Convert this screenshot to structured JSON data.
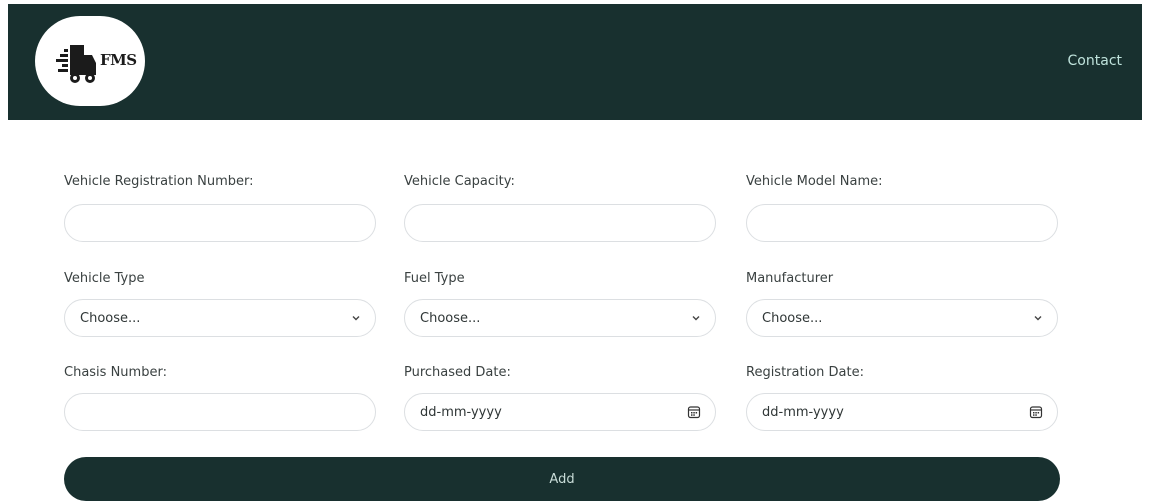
{
  "header": {
    "logo_text": "FMS",
    "nav_contact": "Contact"
  },
  "form": {
    "row1": {
      "reg_number_label": "Vehicle Registration Number:",
      "capacity_label": "Vehicle Capacity:",
      "model_label": "Vehicle Model Name:"
    },
    "row2": {
      "vehicle_type_label": "Vehicle Type",
      "vehicle_type_value": "Choose...",
      "fuel_type_label": "Fuel Type",
      "fuel_type_value": "Choose...",
      "manufacturer_label": "Manufacturer",
      "manufacturer_value": "Choose..."
    },
    "row3": {
      "chasis_label": "Chasis Number:",
      "purchased_label": "Purchased Date:",
      "purchased_placeholder": "dd-mm-yyyy",
      "registration_label": "Registration Date:",
      "registration_placeholder": "dd-mm-yyyy"
    },
    "submit_label": "Add"
  },
  "icons": {
    "logo": "truck-logo-icon",
    "select": "chevron-down-icon",
    "date": "calendar-icon"
  },
  "colors": {
    "navbar_bg": "#18302f",
    "nav_link": "#bfe3dc",
    "button_bg": "#18302f",
    "button_text": "#c9dcd8",
    "input_border": "#dcdfe2"
  }
}
